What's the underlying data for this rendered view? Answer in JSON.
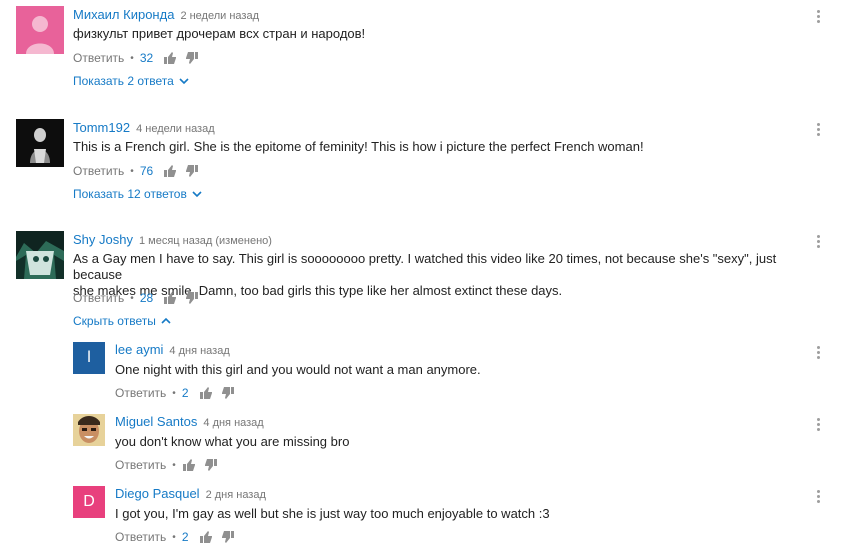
{
  "comments": [
    {
      "author": "Михаил Киронда",
      "time": "2 недели назад",
      "text": "физкульт привет дрочерам всх стран и народов!",
      "reply_label": "Ответить",
      "likes": "32",
      "toggle_label": "Показать 2 ответа",
      "avatar_color": "#e8629a"
    },
    {
      "author": "Tomm192",
      "time": "4 недели назад",
      "text": "This is a French girl. She is the epitome of feminity! This is how i  picture the perfect French woman!",
      "reply_label": "Ответить",
      "likes": "76",
      "toggle_label": "Показать 12 ответов"
    },
    {
      "author": "Shy Joshy",
      "time": "1 месяц назад (изменено)",
      "text_line1": "As a Gay men I have to say. This girl is soooooooo pretty. I watched this video like 20 times, not because she's \"sexy\", just because",
      "text_line2": "she makes me smile. Damn, too bad girls this type like her almost extinct these days.",
      "reply_label": "Ответить",
      "likes": "28",
      "toggle_label": "Скрыть ответы"
    }
  ],
  "replies": [
    {
      "author": "lee aymi",
      "time": "4 дня назад",
      "text": "One night with this girl and you would not want a man anymore.",
      "reply_label": "Ответить",
      "likes": "2",
      "avatar_letter": "l",
      "avatar_color": "#1e5fa0"
    },
    {
      "author": "Miguel Santos",
      "time": "4 дня назад",
      "text": "you don't know what you are missing bro",
      "reply_label": "Ответить",
      "likes": ""
    },
    {
      "author": "Diego Pasquel",
      "time": "2 дня назад",
      "text": "I got you, I'm gay as well but she is just way too much enjoyable to watch :3",
      "reply_label": "Ответить",
      "likes": "2",
      "avatar_letter": "D",
      "avatar_color": "#e8407d"
    }
  ],
  "colors": {
    "link": "#167ac6",
    "meta": "#767676",
    "thumb": "#909090"
  }
}
